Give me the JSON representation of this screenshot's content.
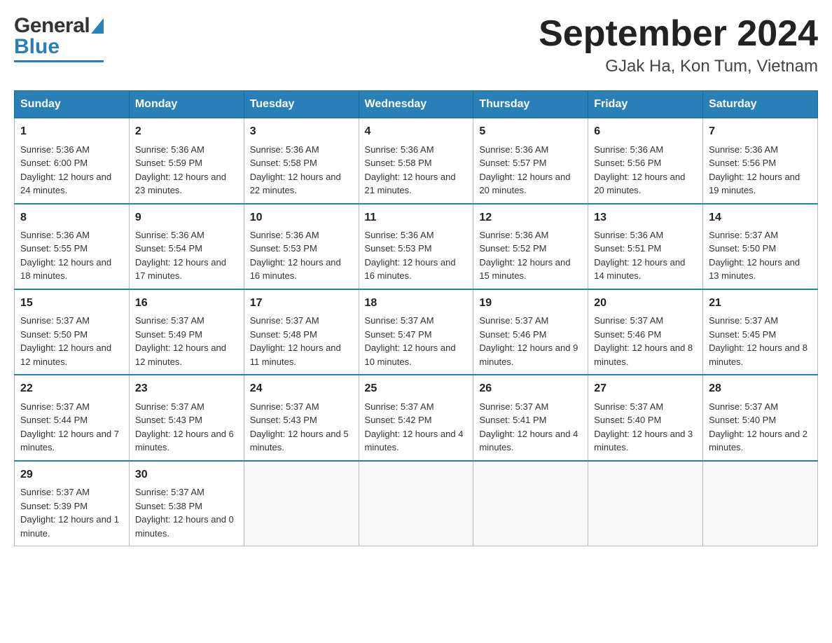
{
  "header": {
    "logo_general": "General",
    "logo_blue": "Blue",
    "title": "September 2024",
    "subtitle": "GJak Ha, Kon Tum, Vietnam"
  },
  "days_of_week": [
    "Sunday",
    "Monday",
    "Tuesday",
    "Wednesday",
    "Thursday",
    "Friday",
    "Saturday"
  ],
  "weeks": [
    [
      {
        "day": "1",
        "sunrise": "Sunrise: 5:36 AM",
        "sunset": "Sunset: 6:00 PM",
        "daylight": "Daylight: 12 hours and 24 minutes."
      },
      {
        "day": "2",
        "sunrise": "Sunrise: 5:36 AM",
        "sunset": "Sunset: 5:59 PM",
        "daylight": "Daylight: 12 hours and 23 minutes."
      },
      {
        "day": "3",
        "sunrise": "Sunrise: 5:36 AM",
        "sunset": "Sunset: 5:58 PM",
        "daylight": "Daylight: 12 hours and 22 minutes."
      },
      {
        "day": "4",
        "sunrise": "Sunrise: 5:36 AM",
        "sunset": "Sunset: 5:58 PM",
        "daylight": "Daylight: 12 hours and 21 minutes."
      },
      {
        "day": "5",
        "sunrise": "Sunrise: 5:36 AM",
        "sunset": "Sunset: 5:57 PM",
        "daylight": "Daylight: 12 hours and 20 minutes."
      },
      {
        "day": "6",
        "sunrise": "Sunrise: 5:36 AM",
        "sunset": "Sunset: 5:56 PM",
        "daylight": "Daylight: 12 hours and 20 minutes."
      },
      {
        "day": "7",
        "sunrise": "Sunrise: 5:36 AM",
        "sunset": "Sunset: 5:56 PM",
        "daylight": "Daylight: 12 hours and 19 minutes."
      }
    ],
    [
      {
        "day": "8",
        "sunrise": "Sunrise: 5:36 AM",
        "sunset": "Sunset: 5:55 PM",
        "daylight": "Daylight: 12 hours and 18 minutes."
      },
      {
        "day": "9",
        "sunrise": "Sunrise: 5:36 AM",
        "sunset": "Sunset: 5:54 PM",
        "daylight": "Daylight: 12 hours and 17 minutes."
      },
      {
        "day": "10",
        "sunrise": "Sunrise: 5:36 AM",
        "sunset": "Sunset: 5:53 PM",
        "daylight": "Daylight: 12 hours and 16 minutes."
      },
      {
        "day": "11",
        "sunrise": "Sunrise: 5:36 AM",
        "sunset": "Sunset: 5:53 PM",
        "daylight": "Daylight: 12 hours and 16 minutes."
      },
      {
        "day": "12",
        "sunrise": "Sunrise: 5:36 AM",
        "sunset": "Sunset: 5:52 PM",
        "daylight": "Daylight: 12 hours and 15 minutes."
      },
      {
        "day": "13",
        "sunrise": "Sunrise: 5:36 AM",
        "sunset": "Sunset: 5:51 PM",
        "daylight": "Daylight: 12 hours and 14 minutes."
      },
      {
        "day": "14",
        "sunrise": "Sunrise: 5:37 AM",
        "sunset": "Sunset: 5:50 PM",
        "daylight": "Daylight: 12 hours and 13 minutes."
      }
    ],
    [
      {
        "day": "15",
        "sunrise": "Sunrise: 5:37 AM",
        "sunset": "Sunset: 5:50 PM",
        "daylight": "Daylight: 12 hours and 12 minutes."
      },
      {
        "day": "16",
        "sunrise": "Sunrise: 5:37 AM",
        "sunset": "Sunset: 5:49 PM",
        "daylight": "Daylight: 12 hours and 12 minutes."
      },
      {
        "day": "17",
        "sunrise": "Sunrise: 5:37 AM",
        "sunset": "Sunset: 5:48 PM",
        "daylight": "Daylight: 12 hours and 11 minutes."
      },
      {
        "day": "18",
        "sunrise": "Sunrise: 5:37 AM",
        "sunset": "Sunset: 5:47 PM",
        "daylight": "Daylight: 12 hours and 10 minutes."
      },
      {
        "day": "19",
        "sunrise": "Sunrise: 5:37 AM",
        "sunset": "Sunset: 5:46 PM",
        "daylight": "Daylight: 12 hours and 9 minutes."
      },
      {
        "day": "20",
        "sunrise": "Sunrise: 5:37 AM",
        "sunset": "Sunset: 5:46 PM",
        "daylight": "Daylight: 12 hours and 8 minutes."
      },
      {
        "day": "21",
        "sunrise": "Sunrise: 5:37 AM",
        "sunset": "Sunset: 5:45 PM",
        "daylight": "Daylight: 12 hours and 8 minutes."
      }
    ],
    [
      {
        "day": "22",
        "sunrise": "Sunrise: 5:37 AM",
        "sunset": "Sunset: 5:44 PM",
        "daylight": "Daylight: 12 hours and 7 minutes."
      },
      {
        "day": "23",
        "sunrise": "Sunrise: 5:37 AM",
        "sunset": "Sunset: 5:43 PM",
        "daylight": "Daylight: 12 hours and 6 minutes."
      },
      {
        "day": "24",
        "sunrise": "Sunrise: 5:37 AM",
        "sunset": "Sunset: 5:43 PM",
        "daylight": "Daylight: 12 hours and 5 minutes."
      },
      {
        "day": "25",
        "sunrise": "Sunrise: 5:37 AM",
        "sunset": "Sunset: 5:42 PM",
        "daylight": "Daylight: 12 hours and 4 minutes."
      },
      {
        "day": "26",
        "sunrise": "Sunrise: 5:37 AM",
        "sunset": "Sunset: 5:41 PM",
        "daylight": "Daylight: 12 hours and 4 minutes."
      },
      {
        "day": "27",
        "sunrise": "Sunrise: 5:37 AM",
        "sunset": "Sunset: 5:40 PM",
        "daylight": "Daylight: 12 hours and 3 minutes."
      },
      {
        "day": "28",
        "sunrise": "Sunrise: 5:37 AM",
        "sunset": "Sunset: 5:40 PM",
        "daylight": "Daylight: 12 hours and 2 minutes."
      }
    ],
    [
      {
        "day": "29",
        "sunrise": "Sunrise: 5:37 AM",
        "sunset": "Sunset: 5:39 PM",
        "daylight": "Daylight: 12 hours and 1 minute."
      },
      {
        "day": "30",
        "sunrise": "Sunrise: 5:37 AM",
        "sunset": "Sunset: 5:38 PM",
        "daylight": "Daylight: 12 hours and 0 minutes."
      },
      null,
      null,
      null,
      null,
      null
    ]
  ]
}
